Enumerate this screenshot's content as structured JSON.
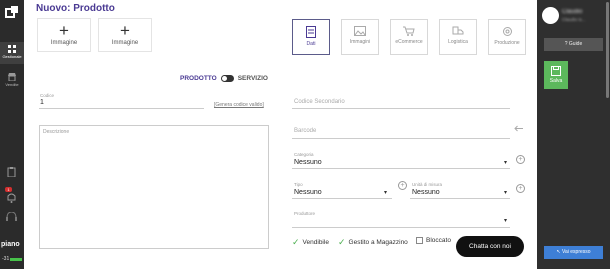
{
  "sidebar": {
    "items": [
      {
        "label": "Gestionale",
        "icon": "grid-icon"
      },
      {
        "label": "Vendite",
        "icon": "shop-icon"
      }
    ],
    "badge": "1",
    "plan_label": "piano",
    "plan_days": "-31"
  },
  "page": {
    "title": "Nuovo: Prodotto",
    "images": [
      {
        "label": "Immagine"
      },
      {
        "label": "Immagine"
      }
    ],
    "tabs": [
      {
        "label": "Dati",
        "icon": "calculator-icon",
        "active": true
      },
      {
        "label": "Immagini",
        "icon": "image-icon"
      },
      {
        "label": "eCommerce",
        "icon": "cart-icon"
      },
      {
        "label": "Logistica",
        "icon": "truck-icon"
      },
      {
        "label": "Produzione",
        "icon": "gear-icon"
      }
    ],
    "toggle": {
      "left": "PRODOTTO",
      "right": "SERVIZIO"
    },
    "codice": {
      "label": "Codice",
      "value": "1",
      "link": "[Genera codice valido]"
    },
    "codice_secondario": {
      "placeholder": "Codice Secondario"
    },
    "descrizione": {
      "placeholder": "Descrizione"
    },
    "barcode": {
      "placeholder": "Barcode"
    },
    "categoria": {
      "label": "Categoria",
      "value": "Nessuno"
    },
    "tipo": {
      "label": "Tipo",
      "value": "Nessuno"
    },
    "unita": {
      "label": "Unità di misura",
      "value": "Nessuno"
    },
    "produttore": {
      "label": "Produttore",
      "value": ""
    },
    "checks": [
      {
        "label": "Vendibile",
        "checked": true
      },
      {
        "label": "Gestito a Magazzino",
        "checked": true
      },
      {
        "label": "Bloccato",
        "checked": false
      }
    ],
    "chat_label": "Chatta con noi"
  },
  "right_panel": {
    "user_name": "Claudio",
    "user_sub": "Claudio is...",
    "guide_label": "Guide",
    "save_label": "Salva",
    "quick_label": "Vai espresso"
  },
  "colors": {
    "accent": "#4a3a93",
    "save": "#5cb85c",
    "quick": "#3e7fd6",
    "check": "#4caf50"
  }
}
